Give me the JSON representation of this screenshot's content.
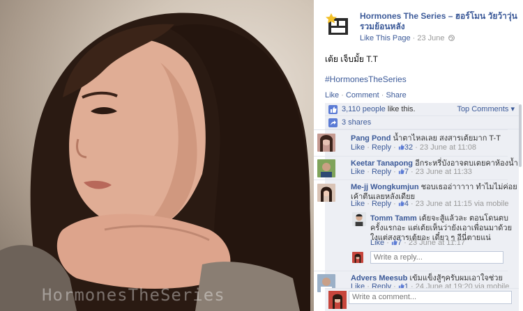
{
  "photo": {
    "watermark": "HormonesTheSeries"
  },
  "page": {
    "name": "Hormones The Series – ฮอร์โมน วัยว้าวุ่น รวมย้อนหลัง",
    "like_page": "Like This Page",
    "separator": " · ",
    "date": "23 June"
  },
  "post": {
    "text": "เต้ย เจ็บมั้ย T.T",
    "hashtag": "#HormonesTheSeries",
    "actions": {
      "like": "Like",
      "comment": "Comment",
      "share": "Share",
      "sep": " · "
    }
  },
  "ufi": {
    "likes_count": "3,110 people",
    "likes_suffix": " like this.",
    "top_comments": "Top Comments ▾",
    "shares": "3 shares"
  },
  "comments": [
    {
      "name": "Pang Pond",
      "text": "น้ำตาไหลเลย สงสารเต้ยมาก T-T",
      "like": "Like",
      "reply": "Reply",
      "likes": "32",
      "time": "23 June at 11:08"
    },
    {
      "name": "Keetar Tanapong",
      "text": "อีกระหรี่บังอาจตบเตยคาห้องน้ำ",
      "like": "Like",
      "reply": "Reply",
      "likes": "7",
      "time": "23 June at 11:33"
    },
    {
      "name": "Me-jj Wongkumjun",
      "text": "ชอบเธออ่าาาาา ทำไมไม่ค่อยเค้าตีนเลยหลังเดียย",
      "like": "Like",
      "reply": "Reply",
      "likes": "4",
      "time": "23 June at 11:15 via mobile"
    },
    {
      "name": "Advers Meesub",
      "text": "เข้มแข็งสู้ๆครับผมเอาใจช่วย",
      "like": "Like",
      "reply": "Reply",
      "likes": "1",
      "time": "24 June at 19:20 via mobile"
    }
  ],
  "reply": {
    "name": "Tomm Tamm",
    "text": "เต้ยจะสู้แล้วละ ตอนโดนตบครั้งแรกอะ แต่เต้ยเห็นว่ายังเอาเพื่อนมาด้วยใงแต่สงสารเต้ยอะ เดี๋ยว ๆ อีนี่ตายแน่",
    "like": "Like",
    "likes": "7",
    "time": "23 June at 11:17",
    "placeholder": "Write a reply..."
  },
  "composer": {
    "placeholder": "Write a comment..."
  },
  "colors": {
    "link": "#3b5998",
    "ufi_bg": "#edeff4"
  }
}
